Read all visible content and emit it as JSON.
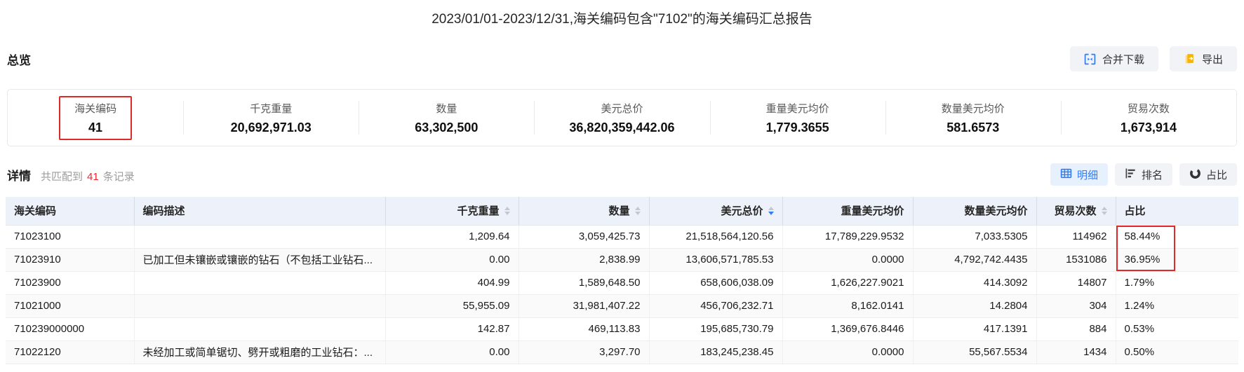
{
  "page": {
    "title": "2023/01/01-2023/12/31,海关编码包含\"7102\"的海关编码汇总报告"
  },
  "overview": {
    "heading": "总览",
    "merge_download_label": "合并下载",
    "export_label": "导出",
    "stats": [
      {
        "label": "海关编码",
        "value": "41",
        "highlighted": true
      },
      {
        "label": "千克重量",
        "value": "20,692,971.03"
      },
      {
        "label": "数量",
        "value": "63,302,500"
      },
      {
        "label": "美元总价",
        "value": "36,820,359,442.06"
      },
      {
        "label": "重量美元均价",
        "value": "1,779.3655"
      },
      {
        "label": "数量美元均价",
        "value": "581.6573"
      },
      {
        "label": "贸易次数",
        "value": "1,673,914"
      }
    ]
  },
  "details": {
    "heading": "详情",
    "match_prefix": "共匹配到",
    "match_count": "41",
    "match_suffix": "条记录",
    "tabs": {
      "detail": "明细",
      "rank": "排名",
      "share": "占比"
    },
    "active_tab": "明细"
  },
  "table": {
    "columns": [
      "海关编码",
      "编码描述",
      "千克重量",
      "数量",
      "美元总价",
      "重量美元均价",
      "数量美元均价",
      "贸易次数",
      "占比"
    ],
    "sorted_column": "美元总价",
    "sort_direction": "desc",
    "rows": [
      [
        "71023100",
        "",
        "1,209.64",
        "3,059,425.73",
        "21,518,564,120.56",
        "17,789,229.9532",
        "7,033.5305",
        "114962",
        "58.44%"
      ],
      [
        "71023910",
        "已加工但未镶嵌或镶嵌的钻石（不包括工业钻石...",
        "0.00",
        "2,838.99",
        "13,606,571,785.53",
        "0.0000",
        "4,792,742.4435",
        "1531086",
        "36.95%"
      ],
      [
        "71023900",
        "",
        "404.99",
        "1,589,648.50",
        "658,606,038.09",
        "1,626,227.9021",
        "414.3092",
        "14807",
        "1.79%"
      ],
      [
        "71021000",
        "",
        "55,955.09",
        "31,981,407.22",
        "456,706,232.71",
        "8,162.0141",
        "14.2804",
        "304",
        "1.24%"
      ],
      [
        "710239000000",
        "",
        "142.87",
        "469,113.83",
        "195,685,730.79",
        "1,369,676.8446",
        "417.1391",
        "884",
        "0.53%"
      ],
      [
        "71022120",
        "未经加工或简单锯切、劈开或粗磨的工业钻石：...",
        "0.00",
        "3,297.70",
        "183,245,238.45",
        "0.0000",
        "55,567.5534",
        "1434",
        "0.50%"
      ]
    ]
  },
  "colors": {
    "accent_blue": "#2f7cf6",
    "highlight_red": "#e02a2a",
    "count_red": "#f5222d",
    "export_orange": "#f7b500",
    "header_bg": "#edf1f9"
  }
}
